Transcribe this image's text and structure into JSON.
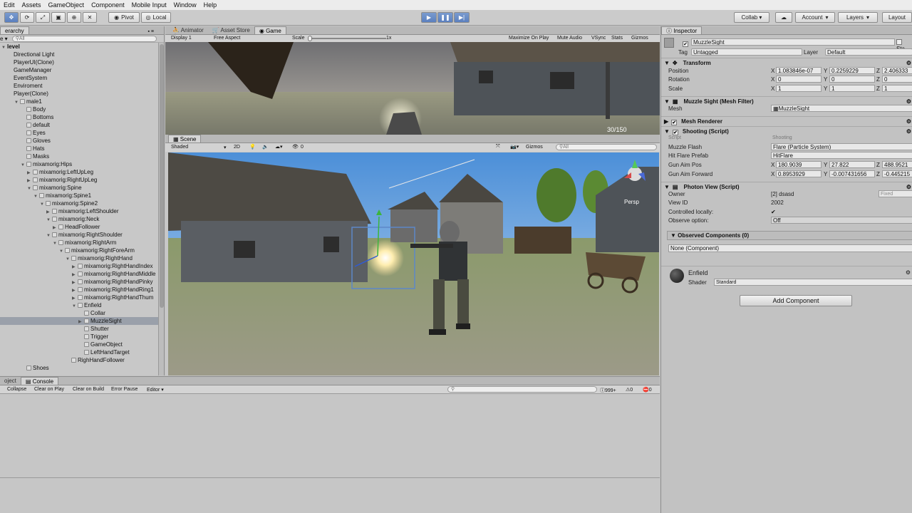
{
  "menu": [
    "Edit",
    "Assets",
    "GameObject",
    "Component",
    "Mobile Input",
    "Window",
    "Help"
  ],
  "toolbar": {
    "pivot": "Pivot",
    "local": "Local",
    "collab": "Collab ▾",
    "account": "Account",
    "layers": "Layers",
    "layout": "Layout"
  },
  "hierarchy": {
    "tab": "erarchy",
    "create": "e ▾",
    "search_placeholder": "All",
    "rows": [
      {
        "label": "level",
        "indent": 0,
        "arrow": "▼",
        "icon": false,
        "bold": true
      },
      {
        "label": "Directional Light",
        "indent": 1,
        "arrow": "",
        "icon": false
      },
      {
        "label": "PlayerUI(Clone)",
        "indent": 1,
        "arrow": "",
        "icon": false
      },
      {
        "label": "GameManager",
        "indent": 1,
        "arrow": "",
        "icon": false
      },
      {
        "label": "EventSystem",
        "indent": 1,
        "arrow": "",
        "icon": false
      },
      {
        "label": "Enviroment",
        "indent": 1,
        "arrow": "",
        "icon": false
      },
      {
        "label": "Player(Clone)",
        "indent": 1,
        "arrow": "",
        "icon": false
      },
      {
        "label": "male1",
        "indent": 2,
        "arrow": "▼",
        "icon": true
      },
      {
        "label": "Body",
        "indent": 3,
        "arrow": "",
        "icon": true
      },
      {
        "label": "Bottoms",
        "indent": 3,
        "arrow": "",
        "icon": true
      },
      {
        "label": "default",
        "indent": 3,
        "arrow": "",
        "icon": true
      },
      {
        "label": "Eyes",
        "indent": 3,
        "arrow": "",
        "icon": true
      },
      {
        "label": "Gloves",
        "indent": 3,
        "arrow": "",
        "icon": true
      },
      {
        "label": "Hats",
        "indent": 3,
        "arrow": "",
        "icon": true
      },
      {
        "label": "Masks",
        "indent": 3,
        "arrow": "",
        "icon": true
      },
      {
        "label": "mixamorig:Hips",
        "indent": 3,
        "arrow": "▼",
        "icon": true
      },
      {
        "label": "mixamorig:LeftUpLeg",
        "indent": 4,
        "arrow": "▶",
        "icon": true
      },
      {
        "label": "mixamorig:RightUpLeg",
        "indent": 4,
        "arrow": "▶",
        "icon": true
      },
      {
        "label": "mixamorig:Spine",
        "indent": 4,
        "arrow": "▼",
        "icon": true
      },
      {
        "label": "mixamorig:Spine1",
        "indent": 5,
        "arrow": "▼",
        "icon": true
      },
      {
        "label": "mixamorig:Spine2",
        "indent": 6,
        "arrow": "▼",
        "icon": true
      },
      {
        "label": "mixamorig:LeftShoulder",
        "indent": 7,
        "arrow": "▶",
        "icon": true
      },
      {
        "label": "mixamorig:Neck",
        "indent": 7,
        "arrow": "▼",
        "icon": true
      },
      {
        "label": "HeadFollower",
        "indent": 8,
        "arrow": "▶",
        "icon": true
      },
      {
        "label": "mixamorig:RightShoulder",
        "indent": 7,
        "arrow": "▼",
        "icon": true
      },
      {
        "label": "mixamorig:RightArm",
        "indent": 8,
        "arrow": "▼",
        "icon": true
      },
      {
        "label": "mixamorig:RightForeArm",
        "indent": 9,
        "arrow": "▼",
        "icon": true
      },
      {
        "label": "mixamorig:RightHand",
        "indent": 10,
        "arrow": "▼",
        "icon": true
      },
      {
        "label": "mixamorig:RightHandIndex",
        "indent": 11,
        "arrow": "▶",
        "icon": true
      },
      {
        "label": "mixamorig:RightHandMiddle",
        "indent": 11,
        "arrow": "▶",
        "icon": true
      },
      {
        "label": "mixamorig:RightHandPinky",
        "indent": 11,
        "arrow": "▶",
        "icon": true
      },
      {
        "label": "mixamorig:RightHandRing1",
        "indent": 11,
        "arrow": "▶",
        "icon": true
      },
      {
        "label": "mixamorig:RightHandThum",
        "indent": 11,
        "arrow": "▶",
        "icon": true
      },
      {
        "label": "Enfield",
        "indent": 11,
        "arrow": "▼",
        "icon": true
      },
      {
        "label": "Collar",
        "indent": 12,
        "arrow": "",
        "icon": true
      },
      {
        "label": "MuzzleSight",
        "indent": 12,
        "arrow": "▶",
        "icon": true,
        "selected": true
      },
      {
        "label": "Shutter",
        "indent": 12,
        "arrow": "",
        "icon": true
      },
      {
        "label": "Trigger",
        "indent": 12,
        "arrow": "",
        "icon": true
      },
      {
        "label": "GameObject",
        "indent": 12,
        "arrow": "",
        "icon": true
      },
      {
        "label": "LeftHandTarget",
        "indent": 12,
        "arrow": "",
        "icon": true
      },
      {
        "label": "RighHandFollower",
        "indent": 10,
        "arrow": "",
        "icon": true
      },
      {
        "label": "Shoes",
        "indent": 3,
        "arrow": "",
        "icon": true
      }
    ]
  },
  "game": {
    "tabs": [
      "Animator",
      "Asset Store",
      "Game"
    ],
    "display": "Display 1",
    "aspect": "Free Aspect",
    "scale_label": "Scale",
    "scale_value": "1x",
    "maximize": "Maximize On Play",
    "mute": "Mute Audio",
    "vsync": "VSync",
    "stats": "Stats",
    "gizmos": "Gizmos",
    "ammo": "30/150"
  },
  "scene": {
    "tab": "Scene",
    "shading": "Shaded",
    "mode2d": "2D",
    "gizmos": "Gizmos",
    "search": "All",
    "fx_count": "0",
    "persp": "Persp"
  },
  "console": {
    "tab_left": "oject",
    "tab": "Console",
    "buttons": [
      "Collapse",
      "Clear on Play",
      "Clear on Build",
      "Error Pause",
      "Editor ▾"
    ],
    "count": "999+",
    "count2": "0"
  },
  "inspector": {
    "tab": "Inspector",
    "object_name": "MuzzleSight",
    "static_label": "Sta",
    "tag_label": "Tag",
    "tag_value": "Untagged",
    "layer_label": "Layer",
    "layer_value": "Default",
    "transform": {
      "title": "Transform",
      "position": {
        "label": "Position",
        "x": "1.083846e-07",
        "y": "0.2259229",
        "z": "2.406333"
      },
      "rotation": {
        "label": "Rotation",
        "x": "0",
        "y": "0",
        "z": "0"
      },
      "scale": {
        "label": "Scale",
        "x": "1",
        "y": "1",
        "z": "1"
      }
    },
    "mesh_filter": {
      "title": "Muzzle Sight (Mesh Filter)",
      "mesh_label": "Mesh",
      "mesh_value": "MuzzleSight"
    },
    "mesh_renderer": {
      "title": "Mesh Renderer"
    },
    "shooting": {
      "title": "Shooting (Script)",
      "script_label": "Script",
      "script_value": "Shooting",
      "muzzle_label": "Muzzle Flash",
      "muzzle_value": "Flare (Particle System)",
      "hitflare_label": "Hit Flare Prefab",
      "hitflare_value": "HitFlare",
      "aimpos_label": "Gun Aim Pos",
      "aimpos": {
        "x": "180.9039",
        "y": "27.822",
        "z": "488.9521"
      },
      "aimfwd_label": "Gun Aim Forward",
      "aimfwd": {
        "x": "0.8953929",
        "y": "-0.007431656",
        "z": "-0.445215"
      }
    },
    "photon": {
      "title": "Photon View (Script)",
      "owner_label": "Owner",
      "owner_value": "[2] dsasd",
      "owner_state": "Fixed",
      "viewid_label": "View ID",
      "viewid_value": "2002",
      "controlled_label": "Controlled locally:",
      "observe_label": "Observe option:",
      "observe_value": "Off",
      "observed_title": "Observed Components (0)",
      "none_component": "None (Component)"
    },
    "material": {
      "name": "Enfield",
      "shader_label": "Shader",
      "shader_value": "Standard"
    },
    "add_component": "Add Component"
  },
  "colors": {
    "play_active": "#5b80bf",
    "selection": "#9aa0aa",
    "panel": "#c8c8c8"
  }
}
